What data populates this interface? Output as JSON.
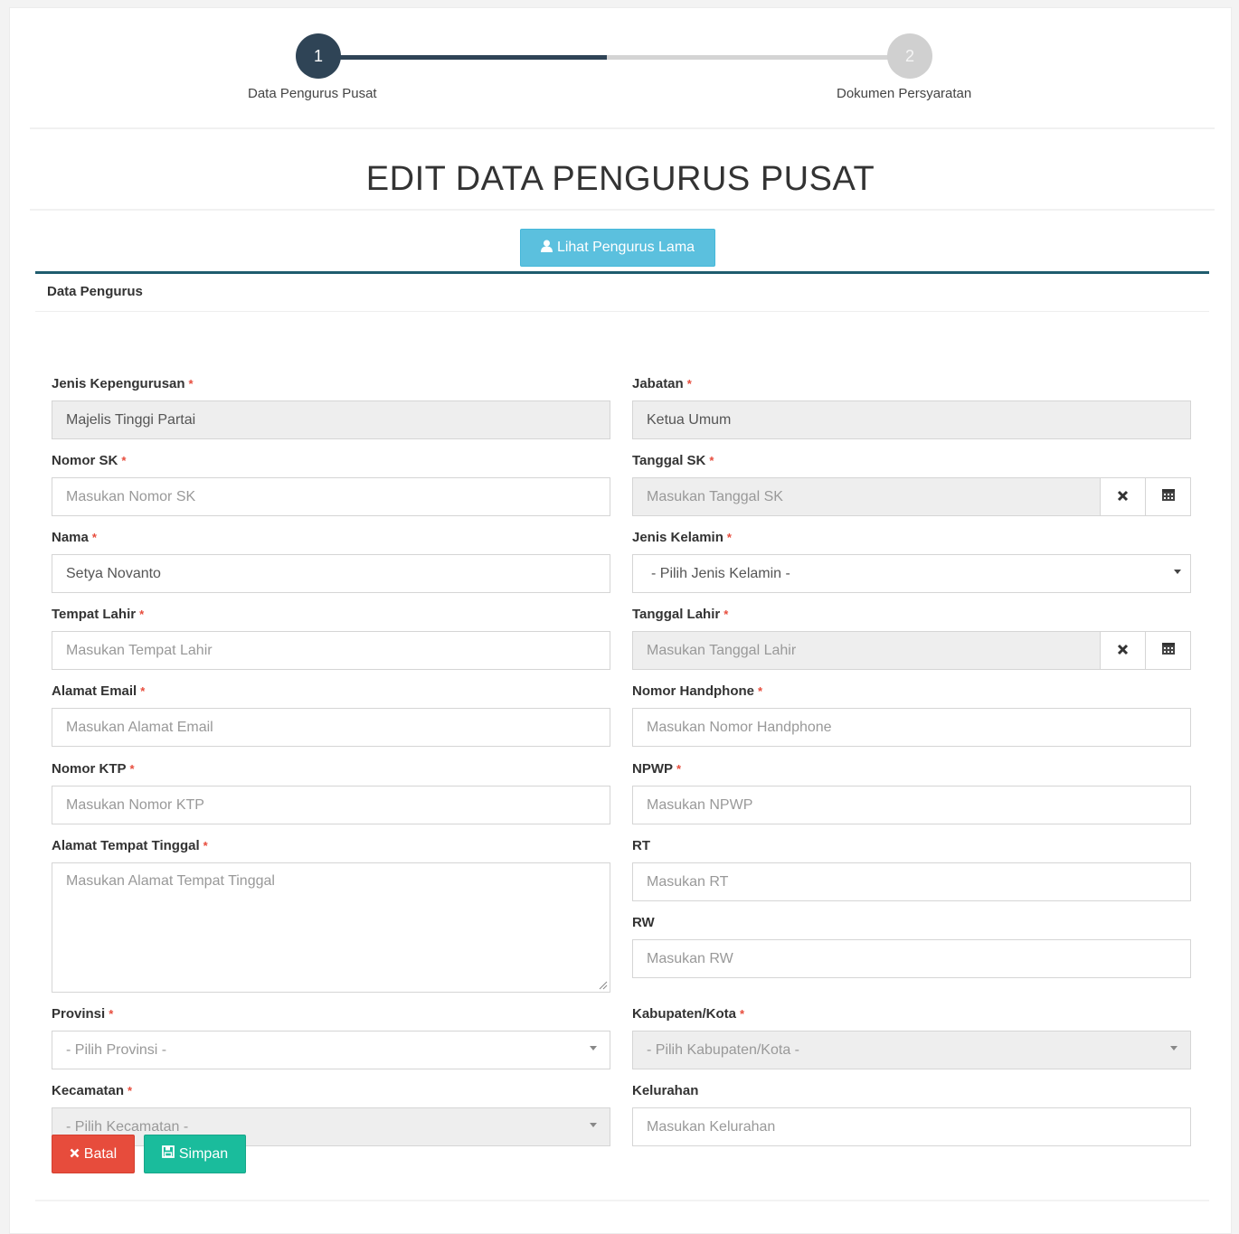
{
  "wizard": {
    "steps": [
      {
        "number": "1",
        "label": "Data Pengurus Pusat"
      },
      {
        "number": "2",
        "label": "Dokumen Persyaratan"
      }
    ]
  },
  "page_title": "EDIT DATA PENGURUS PUSAT",
  "lihat_button": {
    "icon": "user-icon",
    "label": "Lihat Pengurus Lama"
  },
  "panel": {
    "heading": "Data Pengurus"
  },
  "required_mark": "*",
  "form": {
    "jenis_kepengurusan": {
      "label": "Jenis Kepengurusan",
      "value": "Majelis Tinggi Partai"
    },
    "nomor_sk": {
      "label": "Nomor SK",
      "placeholder": "Masukan Nomor SK"
    },
    "nama": {
      "label": "Nama",
      "value": "Setya Novanto"
    },
    "tempat_lahir": {
      "label": "Tempat Lahir",
      "placeholder": "Masukan Tempat Lahir"
    },
    "alamat_email": {
      "label": "Alamat Email",
      "placeholder": "Masukan Alamat Email"
    },
    "nomor_ktp": {
      "label": "Nomor KTP",
      "placeholder": "Masukan Nomor KTP"
    },
    "alamat_tempat_tinggal": {
      "label": "Alamat Tempat Tinggal",
      "placeholder": "Masukan Alamat Tempat Tinggal"
    },
    "provinsi": {
      "label": "Provinsi",
      "selected": "- Pilih Provinsi -"
    },
    "kecamatan": {
      "label": "Kecamatan",
      "selected": "- Pilih Kecamatan -"
    },
    "jabatan": {
      "label": "Jabatan",
      "value": "Ketua Umum"
    },
    "tanggal_sk": {
      "label": "Tanggal SK",
      "placeholder": "Masukan Tanggal SK"
    },
    "jenis_kelamin": {
      "label": "Jenis Kelamin",
      "selected": "- Pilih Jenis Kelamin -"
    },
    "tanggal_lahir": {
      "label": "Tanggal Lahir",
      "placeholder": "Masukan Tanggal Lahir"
    },
    "nomor_handphone": {
      "label": "Nomor Handphone",
      "placeholder": "Masukan Nomor Handphone"
    },
    "npwp": {
      "label": "NPWP",
      "placeholder": "Masukan NPWP"
    },
    "rt": {
      "label": "RT",
      "placeholder": "Masukan RT"
    },
    "rw": {
      "label": "RW",
      "placeholder": "Masukan RW"
    },
    "kabupaten_kota": {
      "label": "Kabupaten/Kota",
      "selected": "- Pilih Kabupaten/Kota -"
    },
    "kelurahan": {
      "label": "Kelurahan",
      "placeholder": "Masukan Kelurahan"
    }
  },
  "date_addons": {
    "clear_icon": "close-icon",
    "calendar_icon": "calendar-icon"
  },
  "actions": {
    "batal": {
      "icon": "close-icon",
      "label": "Batal"
    },
    "simpan": {
      "icon": "save-icon",
      "label": "Simpan"
    }
  },
  "colors": {
    "wizard_active": "#2f4456",
    "wizard_inactive": "#d0d0d0",
    "info": "#5bc0de",
    "danger": "#e74c3c",
    "success": "#1abc9c",
    "panel_border": "#1f5c6e",
    "required": "#e74c3c"
  }
}
